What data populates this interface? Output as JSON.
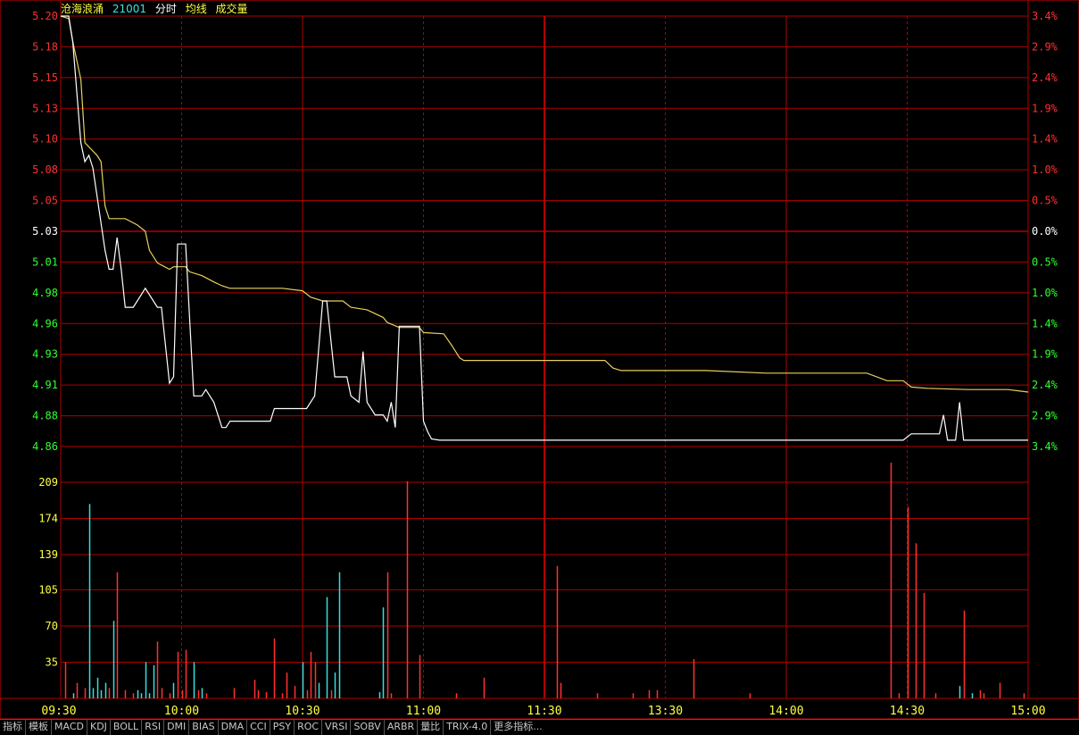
{
  "header": {
    "stock_name": "沧海浪涌",
    "stock_code": "21001",
    "label_time": "分时",
    "label_avg": "均线",
    "label_volume": "成交量"
  },
  "colors": {
    "up": "#ff3030",
    "down": "#30ff30",
    "flat": "#ffffff",
    "grid": "#b00000",
    "price_line": "#ffffff",
    "avg_line": "#e8d060",
    "vol_up": "#ff3030",
    "vol_down": "#30e0e0",
    "volume_tick": "#ffff40",
    "time_label": "#ffff40"
  },
  "tabs": [
    "指标",
    "模板",
    "MACD",
    "KDJ",
    "BOLL",
    "RSI",
    "DMI",
    "BIAS",
    "DMA",
    "CCI",
    "PSY",
    "ROC",
    "VRSI",
    "SOBV",
    "ARBR",
    "量比",
    "TRIX-4.0",
    "更多指标..."
  ],
  "chart_data": {
    "type": "line",
    "price_axis_left": [
      "5.20",
      "5.18",
      "5.15",
      "5.13",
      "5.10",
      "5.08",
      "5.05",
      "5.03",
      "5.01",
      "4.98",
      "4.96",
      "4.93",
      "4.91",
      "4.88",
      "4.86"
    ],
    "percent_axis_right": [
      "3.4%",
      "2.9%",
      "2.4%",
      "1.9%",
      "1.4%",
      "1.0%",
      "0.5%",
      "0.0%",
      "0.5%",
      "1.0%",
      "1.4%",
      "1.9%",
      "2.4%",
      "2.9%",
      "3.4%"
    ],
    "ylim": [
      4.86,
      5.2
    ],
    "prev_close": 5.03,
    "volume_axis": [
      "209",
      "174",
      "139",
      "105",
      "70",
      "35"
    ],
    "volume_ylim": [
      0,
      209
    ],
    "time_labels": [
      "09:30",
      "10:00",
      "10:30",
      "11:00",
      "11:30",
      "13:30",
      "14:00",
      "14:30",
      "15:00"
    ],
    "price": [
      [
        0,
        5.2
      ],
      [
        2,
        5.2
      ],
      [
        3,
        5.18
      ],
      [
        5,
        5.1
      ],
      [
        6,
        5.085
      ],
      [
        7,
        5.09
      ],
      [
        8,
        5.08
      ],
      [
        11,
        5.015
      ],
      [
        12,
        5.0
      ],
      [
        13,
        5.0
      ],
      [
        14,
        5.025
      ],
      [
        15,
        5.0
      ],
      [
        16,
        4.97
      ],
      [
        18,
        4.97
      ],
      [
        20,
        4.98
      ],
      [
        21,
        4.985
      ],
      [
        24,
        4.97
      ],
      [
        25,
        4.97
      ],
      [
        27,
        4.91
      ],
      [
        28,
        4.915
      ],
      [
        29,
        5.02
      ],
      [
        31,
        5.02
      ],
      [
        33,
        4.9
      ],
      [
        35,
        4.9
      ],
      [
        36,
        4.905
      ],
      [
        38,
        4.895
      ],
      [
        40,
        4.875
      ],
      [
        41,
        4.875
      ],
      [
        42,
        4.88
      ],
      [
        52,
        4.88
      ],
      [
        53,
        4.89
      ],
      [
        61,
        4.89
      ],
      [
        63,
        4.9
      ],
      [
        65,
        4.975
      ],
      [
        66,
        4.975
      ],
      [
        68,
        4.915
      ],
      [
        71,
        4.915
      ],
      [
        72,
        4.9
      ],
      [
        74,
        4.895
      ],
      [
        75,
        4.935
      ],
      [
        76,
        4.895
      ],
      [
        78,
        4.885
      ],
      [
        80,
        4.885
      ],
      [
        81,
        4.88
      ],
      [
        82,
        4.895
      ],
      [
        83,
        4.875
      ],
      [
        84,
        4.955
      ],
      [
        89,
        4.955
      ],
      [
        90,
        4.88
      ],
      [
        91,
        4.872
      ],
      [
        92,
        4.866
      ],
      [
        94,
        4.865
      ],
      [
        209,
        4.865
      ],
      [
        211,
        4.87
      ],
      [
        218,
        4.87
      ],
      [
        219,
        4.885
      ],
      [
        220,
        4.865
      ],
      [
        222,
        4.865
      ],
      [
        223,
        4.895
      ],
      [
        224,
        4.865
      ],
      [
        240,
        4.865
      ]
    ],
    "average": [
      [
        0,
        5.2
      ],
      [
        2,
        5.198
      ],
      [
        3,
        5.18
      ],
      [
        5,
        5.15
      ],
      [
        6,
        5.1
      ],
      [
        9,
        5.09
      ],
      [
        10,
        5.085
      ],
      [
        11,
        5.05
      ],
      [
        12,
        5.04
      ],
      [
        16,
        5.04
      ],
      [
        19,
        5.035
      ],
      [
        21,
        5.03
      ],
      [
        22,
        5.015
      ],
      [
        24,
        5.005
      ],
      [
        27,
        5.0
      ],
      [
        28,
        5.002
      ],
      [
        31,
        5.002
      ],
      [
        32,
        4.998
      ],
      [
        35,
        4.995
      ],
      [
        38,
        4.99
      ],
      [
        40,
        4.987
      ],
      [
        42,
        4.985
      ],
      [
        55,
        4.985
      ],
      [
        60,
        4.983
      ],
      [
        62,
        4.978
      ],
      [
        65,
        4.975
      ],
      [
        70,
        4.975
      ],
      [
        72,
        4.97
      ],
      [
        76,
        4.968
      ],
      [
        80,
        4.962
      ],
      [
        81,
        4.958
      ],
      [
        84,
        4.954
      ],
      [
        89,
        4.954
      ],
      [
        90,
        4.95
      ],
      [
        95,
        4.949
      ],
      [
        97,
        4.94
      ],
      [
        98,
        4.935
      ],
      [
        99,
        4.93
      ],
      [
        100,
        4.928
      ],
      [
        120,
        4.928
      ],
      [
        135,
        4.928
      ],
      [
        137,
        4.922
      ],
      [
        139,
        4.92
      ],
      [
        160,
        4.92
      ],
      [
        175,
        4.918
      ],
      [
        200,
        4.918
      ],
      [
        205,
        4.912
      ],
      [
        209,
        4.912
      ],
      [
        211,
        4.907
      ],
      [
        215,
        4.906
      ],
      [
        225,
        4.905
      ],
      [
        235,
        4.905
      ],
      [
        240,
        4.903
      ]
    ],
    "volume": [
      [
        1,
        35,
        "up"
      ],
      [
        3,
        5,
        "down"
      ],
      [
        4,
        15,
        "up"
      ],
      [
        6,
        10,
        "up"
      ],
      [
        7,
        188,
        "down"
      ],
      [
        8,
        10,
        "down"
      ],
      [
        9,
        20,
        "down"
      ],
      [
        10,
        8,
        "down"
      ],
      [
        11,
        15,
        "down"
      ],
      [
        12,
        10,
        "up"
      ],
      [
        13,
        75,
        "down"
      ],
      [
        14,
        122,
        "up"
      ],
      [
        16,
        8,
        "up"
      ],
      [
        18,
        5,
        "up"
      ],
      [
        19,
        8,
        "down"
      ],
      [
        20,
        5,
        "down"
      ],
      [
        21,
        35,
        "down"
      ],
      [
        22,
        5,
        "down"
      ],
      [
        23,
        32,
        "down"
      ],
      [
        24,
        55,
        "up"
      ],
      [
        25,
        10,
        "up"
      ],
      [
        27,
        5,
        "up"
      ],
      [
        28,
        15,
        "down"
      ],
      [
        29,
        45,
        "up"
      ],
      [
        30,
        8,
        "up"
      ],
      [
        31,
        47,
        "up"
      ],
      [
        33,
        35,
        "down"
      ],
      [
        34,
        8,
        "up"
      ],
      [
        35,
        10,
        "down"
      ],
      [
        36,
        5,
        "up"
      ],
      [
        43,
        10,
        "up"
      ],
      [
        48,
        18,
        "up"
      ],
      [
        49,
        8,
        "up"
      ],
      [
        51,
        6,
        "up"
      ],
      [
        53,
        58,
        "up"
      ],
      [
        55,
        5,
        "up"
      ],
      [
        56,
        25,
        "up"
      ],
      [
        58,
        12,
        "up"
      ],
      [
        60,
        35,
        "down"
      ],
      [
        61,
        8,
        "up"
      ],
      [
        62,
        45,
        "up"
      ],
      [
        63,
        35,
        "up"
      ],
      [
        64,
        15,
        "down"
      ],
      [
        66,
        98,
        "down"
      ],
      [
        67,
        8,
        "up"
      ],
      [
        68,
        25,
        "down"
      ],
      [
        69,
        122,
        "down"
      ],
      [
        79,
        6,
        "down"
      ],
      [
        80,
        88,
        "down"
      ],
      [
        81,
        122,
        "up"
      ],
      [
        82,
        5,
        "up"
      ],
      [
        86,
        210,
        "up"
      ],
      [
        89,
        42,
        "up"
      ],
      [
        98,
        5,
        "up"
      ],
      [
        105,
        20,
        "up"
      ],
      [
        123,
        128,
        "up"
      ],
      [
        124,
        15,
        "up"
      ],
      [
        133,
        5,
        "up"
      ],
      [
        142,
        5,
        "up"
      ],
      [
        146,
        8,
        "up"
      ],
      [
        148,
        8,
        "up"
      ],
      [
        157,
        38,
        "up"
      ],
      [
        171,
        5,
        "up"
      ],
      [
        206,
        228,
        "up"
      ],
      [
        208,
        5,
        "up"
      ],
      [
        210,
        185,
        "up"
      ],
      [
        212,
        150,
        "up"
      ],
      [
        214,
        102,
        "up"
      ],
      [
        217,
        5,
        "up"
      ],
      [
        223,
        12,
        "down"
      ],
      [
        224,
        85,
        "up"
      ],
      [
        226,
        5,
        "down"
      ],
      [
        228,
        8,
        "up"
      ],
      [
        229,
        5,
        "up"
      ],
      [
        233,
        15,
        "up"
      ],
      [
        239,
        5,
        "up"
      ]
    ]
  }
}
